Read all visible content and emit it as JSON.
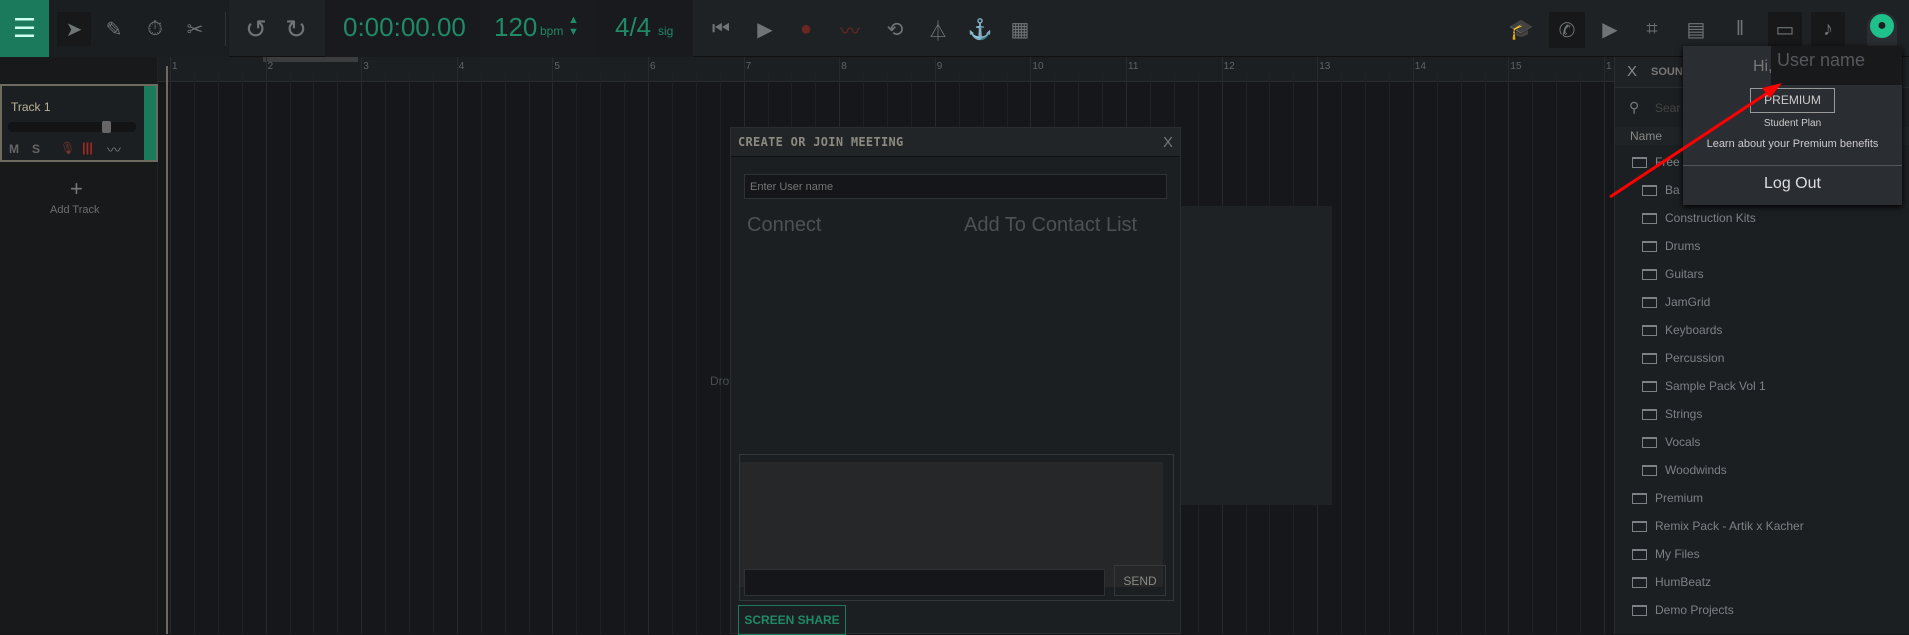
{
  "toolbar": {
    "time": "0:00:00.00",
    "bpm": "120",
    "bpm_unit": "bpm",
    "sig": "4/4",
    "sig_unit": "sig",
    "left_tools": [
      "menu-icon",
      "pointer-icon",
      "pencil-icon",
      "timer-icon",
      "scissors-icon",
      "undo-icon",
      "redo-icon"
    ],
    "transport": [
      "skip-back-icon",
      "play-icon",
      "record-icon",
      "automation-icon",
      "loop-icon",
      "metronome-icon",
      "tuner-icon",
      "audio-settings-icon"
    ],
    "right_tools": [
      "learn-icon",
      "call-icon",
      "video-icon",
      "fx-icon",
      "mixer-icon",
      "piano-icon",
      "add-track-icon",
      "notes-icon",
      "account-icon"
    ],
    "accent": "#1f8a66"
  },
  "ruler": [
    "1",
    "2",
    "3",
    "4",
    "5",
    "6",
    "7",
    "8",
    "9",
    "10",
    "11",
    "12",
    "13",
    "14",
    "15",
    "1"
  ],
  "track": {
    "name": "Track 1",
    "mute": "M",
    "solo": "S",
    "add_label": "Add Track",
    "add_symbol": "+"
  },
  "canvas": {
    "drop_hint": "Dro"
  },
  "dialog": {
    "title": "CREATE OR JOIN MEETING",
    "close": "X",
    "username_placeholder": "Enter User name",
    "connect": "Connect",
    "add_contact": "Add To Contact List",
    "send": "SEND",
    "screen_share": "SCREEN SHARE"
  },
  "sound": {
    "title": "SOUNI",
    "close": "X",
    "search_placeholder": "Sear",
    "col_name": "Name",
    "items": [
      {
        "label": "Free",
        "level": 0
      },
      {
        "label": "Ba",
        "level": 1
      },
      {
        "label": "Construction Kits",
        "level": 1
      },
      {
        "label": "Drums",
        "level": 1
      },
      {
        "label": "Guitars",
        "level": 1
      },
      {
        "label": "JamGrid",
        "level": 1
      },
      {
        "label": "Keyboards",
        "level": 1
      },
      {
        "label": "Percussion",
        "level": 1
      },
      {
        "label": "Sample Pack Vol 1",
        "level": 1
      },
      {
        "label": "Strings",
        "level": 1
      },
      {
        "label": "Vocals",
        "level": 1
      },
      {
        "label": "Woodwinds",
        "level": 1
      },
      {
        "label": "Premium",
        "level": 0
      },
      {
        "label": "Remix Pack - Artik x Kacher",
        "level": 0
      },
      {
        "label": "My Files",
        "level": 0
      },
      {
        "label": "HumBeatz",
        "level": 0
      },
      {
        "label": "Demo Projects",
        "level": 0
      }
    ]
  },
  "account": {
    "greeting": "Hi,",
    "username": "User name",
    "badge": "PREMIUM",
    "plan": "Student Plan",
    "benefits": "Learn about your Premium benefits",
    "logout": "Log Out"
  },
  "annotation": {
    "arrow_color": "#ff0000"
  }
}
